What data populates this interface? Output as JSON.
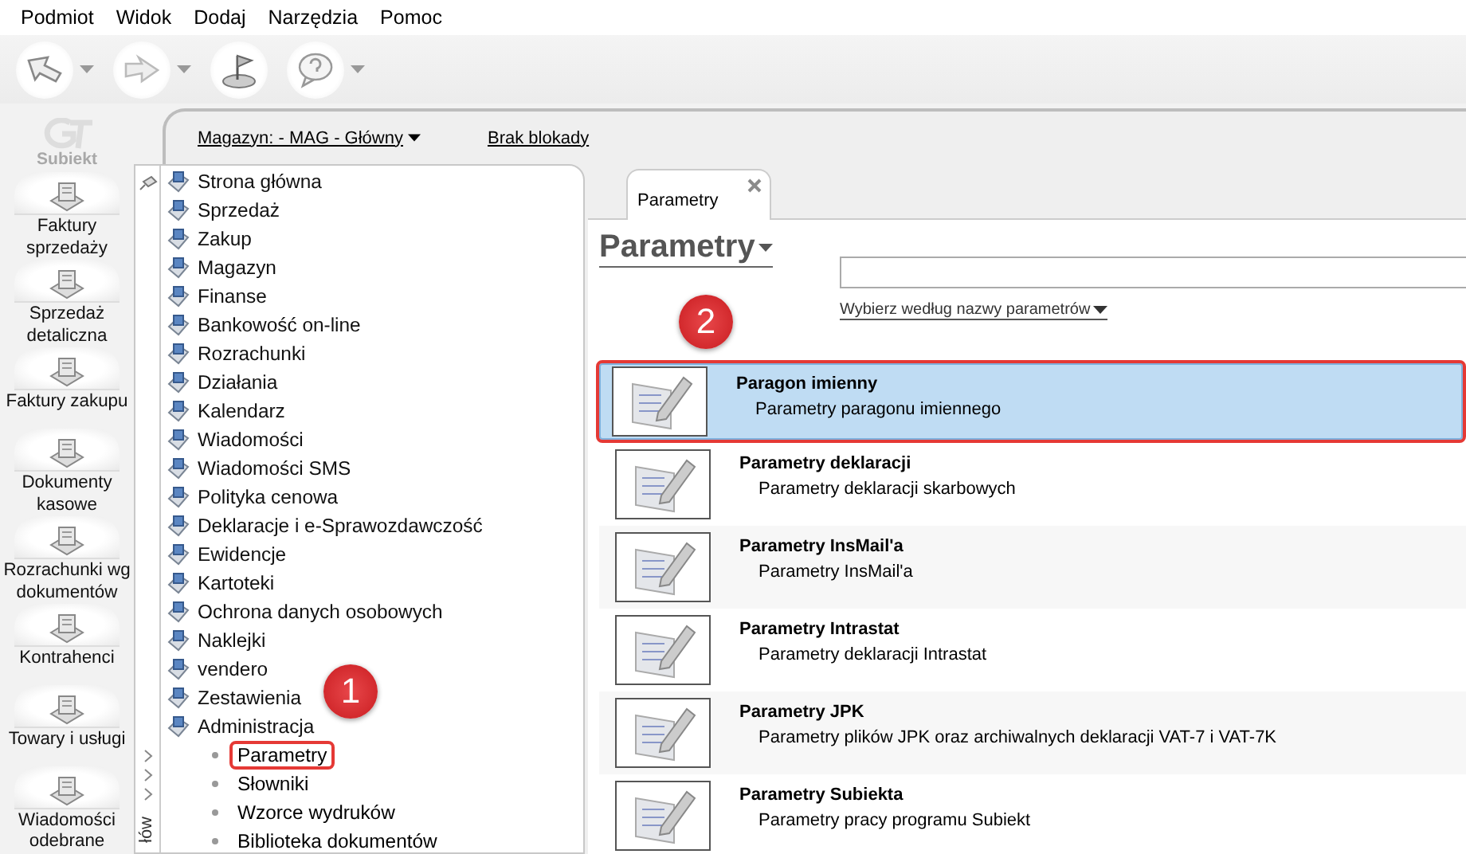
{
  "menu": [
    {
      "label": "Podmiot"
    },
    {
      "label": "Widok"
    },
    {
      "label": "Dodaj"
    },
    {
      "label": "Narzędzia"
    },
    {
      "label": "Pomoc"
    }
  ],
  "toolbar": [
    {
      "dropdown": true
    },
    {
      "dropdown": true
    },
    {
      "dropdown": false
    },
    {
      "dropdown": true
    }
  ],
  "logo": {
    "text": "Subiekt"
  },
  "nav": [
    {
      "label": "Faktury sprzedaży"
    },
    {
      "label": "Sprzedaż detaliczna"
    },
    {
      "label": "Faktury zakupu"
    },
    {
      "label": "Dokumenty kasowe"
    },
    {
      "label": "Rozrachunki wg dokumentów"
    },
    {
      "label": "Kontrahenci"
    },
    {
      "label": "Towary i usługi"
    },
    {
      "label": "Wiadomości odebrane"
    }
  ],
  "header": {
    "warehouse": "Magazyn: - MAG - Główny",
    "lock": "Brak blokady"
  },
  "tree": {
    "side_label": "łów",
    "items": [
      {
        "label": "Strona główna"
      },
      {
        "label": "Sprzedaż"
      },
      {
        "label": "Zakup"
      },
      {
        "label": "Magazyn"
      },
      {
        "label": "Finanse"
      },
      {
        "label": "Bankowość on-line"
      },
      {
        "label": "Rozrachunki"
      },
      {
        "label": "Działania"
      },
      {
        "label": "Kalendarz"
      },
      {
        "label": "Wiadomości"
      },
      {
        "label": "Wiadomości SMS"
      },
      {
        "label": "Polityka cenowa"
      },
      {
        "label": "Deklaracje i e-Sprawozdawczość"
      },
      {
        "label": "Ewidencje"
      },
      {
        "label": "Kartoteki"
      },
      {
        "label": "Ochrona danych osobowych"
      },
      {
        "label": "Naklejki"
      },
      {
        "label": "vendero"
      },
      {
        "label": "Zestawienia"
      },
      {
        "label": "Administracja",
        "children": [
          {
            "label": "Parametry",
            "selected": true
          },
          {
            "label": "Słowniki",
            "selected": false
          },
          {
            "label": "Wzorce wydruków",
            "selected": false
          },
          {
            "label": "Biblioteka dokumentów",
            "selected": false
          }
        ]
      }
    ]
  },
  "tabs": [
    {
      "label": "Parametry",
      "selected": true
    }
  ],
  "page": {
    "title": "Parametry",
    "filter_link": "Wybierz według nazwy parametrów"
  },
  "rows": [
    {
      "title": "Paragon imienny",
      "description": "Parametry paragonu imiennego",
      "selected": true
    },
    {
      "title": "Parametry deklaracji",
      "description": "Parametry deklaracji skarbowych",
      "selected": false
    },
    {
      "title": "Parametry InsMail'a",
      "description": "Parametry InsMail'a",
      "selected": false
    },
    {
      "title": "Parametry Intrastat",
      "description": "Parametry deklaracji Intrastat",
      "selected": false
    },
    {
      "title": "Parametry JPK",
      "description": "Parametry plików JPK oraz archiwalnych deklaracji VAT-7 i VAT-7K",
      "selected": false
    },
    {
      "title": "Parametry Subiekta",
      "description": "Parametry pracy programu Subiekt",
      "selected": false
    }
  ],
  "callouts": [
    {
      "label": "1"
    },
    {
      "label": "2"
    }
  ]
}
